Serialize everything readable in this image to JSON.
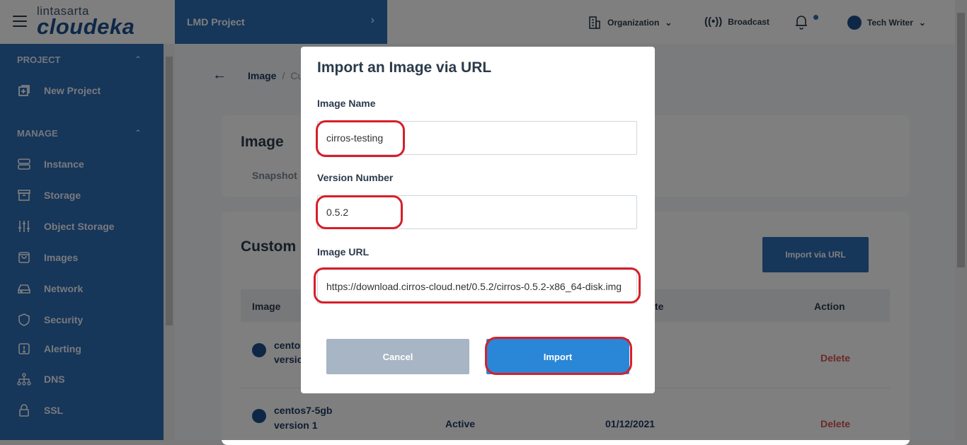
{
  "brand": {
    "top": "lintasarta",
    "main": "cloudeka"
  },
  "header": {
    "project_name": "LMD Project",
    "organization_label": "Organization",
    "broadcast_label": "Broadcast",
    "user_label": "Tech Writer"
  },
  "sidebar": {
    "project_section": "PROJECT",
    "new_project": "New Project",
    "manage_section": "MANAGE",
    "items": [
      {
        "label": "Instance",
        "icon": "server-icon"
      },
      {
        "label": "Storage",
        "icon": "archive-icon"
      },
      {
        "label": "Object Storage",
        "icon": "sliders-icon"
      },
      {
        "label": "Images",
        "icon": "bag-icon"
      },
      {
        "label": "Network",
        "icon": "hard-drive-icon"
      },
      {
        "label": "Security",
        "icon": "shield-icon"
      },
      {
        "label": "Alerting",
        "icon": "alert-icon"
      },
      {
        "label": "DNS",
        "icon": "sitemap-icon"
      },
      {
        "label": "SSL",
        "icon": "lock-icon"
      }
    ]
  },
  "page": {
    "breadcrumb_root": "Image",
    "breadcrumb_sep": "/",
    "breadcrumb_current": "Cust",
    "image_title": "Image",
    "tab_snapshot": "Snapshot",
    "custom_title": "Custom I",
    "import_url_button": "Import via URL",
    "table": {
      "col_image": "Image",
      "col_date_partial": "te",
      "col_action": "Action",
      "rows": [
        {
          "name": "centos",
          "version": "version",
          "status": "",
          "date": "",
          "action": "Delete"
        },
        {
          "name": "centos7-5gb",
          "version": "version 1",
          "status": "Active",
          "date": "01/12/2021",
          "action": "Delete"
        }
      ]
    }
  },
  "modal": {
    "title": "Import an Image via URL",
    "image_name_label": "Image Name",
    "image_name_value": "cirros-testing",
    "version_label": "Version Number",
    "version_value": "0.5.2",
    "url_label": "Image URL",
    "url_value": "https://download.cirros-cloud.net/0.5.2/cirros-0.5.2-x86_64-disk.img",
    "cancel_label": "Cancel",
    "import_label": "Import"
  },
  "colors": {
    "brand_blue": "#2c6cb5",
    "cancel_gray": "#a7b5c4",
    "import_blue": "#2a86d6",
    "highlight_red": "#d61f2a",
    "delete_red": "#d9534f"
  }
}
